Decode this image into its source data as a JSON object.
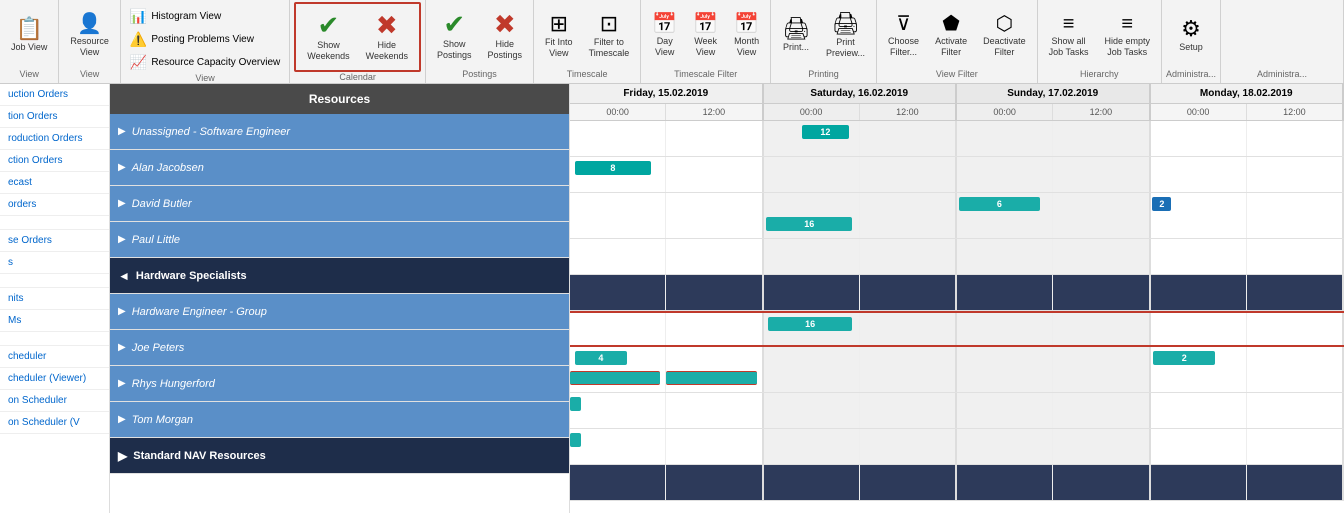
{
  "toolbar": {
    "groups": [
      {
        "id": "job-view",
        "label": "View",
        "buttons": [
          {
            "id": "job-view-btn",
            "icon": "📋",
            "label": "Job\nView",
            "type": "large"
          }
        ]
      },
      {
        "id": "resource-view",
        "label": "View",
        "buttons": [
          {
            "id": "resource-view-btn",
            "icon": "👤",
            "label": "Resource\nView",
            "type": "large"
          }
        ]
      },
      {
        "id": "view-group",
        "label": "View",
        "sub_buttons": [
          {
            "id": "histogram-view",
            "icon": "📊",
            "label": "Histogram View"
          },
          {
            "id": "posting-problems",
            "icon": "⚠️",
            "label": "Posting Problems View"
          },
          {
            "id": "resource-capacity",
            "icon": "📈",
            "label": "Resource Capacity Overview"
          }
        ]
      },
      {
        "id": "calendar-group",
        "label": "Calendar",
        "buttons": [
          {
            "id": "show-weekends",
            "icon": "✔",
            "label": "Show\nWeekends",
            "color": "green"
          },
          {
            "id": "hide-weekends",
            "icon": "✖",
            "label": "Hide\nWeekends",
            "color": "red"
          }
        ]
      },
      {
        "id": "postings-group",
        "label": "Postings",
        "buttons": [
          {
            "id": "show-postings",
            "icon": "✔",
            "label": "Show\nPostings",
            "color": "green"
          },
          {
            "id": "hide-postings",
            "icon": "✖",
            "label": "Hide\nPostings",
            "color": "red"
          }
        ]
      },
      {
        "id": "timescale-group",
        "label": "Timescale",
        "buttons": [
          {
            "id": "fit-into-view",
            "icon": "⊞",
            "label": "Fit Into\nView"
          },
          {
            "id": "filter-timescale",
            "icon": "⊡",
            "label": "Filter to\nTimescale"
          }
        ]
      },
      {
        "id": "day-week-month-group",
        "label": "Timescale Filter",
        "buttons": [
          {
            "id": "day-view",
            "icon": "📅",
            "label": "Day\nView"
          },
          {
            "id": "week-view",
            "icon": "📅",
            "label": "Week\nView"
          },
          {
            "id": "month-view",
            "icon": "📅",
            "label": "Month\nView"
          }
        ]
      },
      {
        "id": "printing-group",
        "label": "Printing",
        "buttons": [
          {
            "id": "print-btn",
            "icon": "🖨",
            "label": "Print..."
          },
          {
            "id": "print-preview",
            "icon": "🖨",
            "label": "Print\nPreview..."
          }
        ]
      },
      {
        "id": "view-filter-group",
        "label": "View Filter",
        "buttons": [
          {
            "id": "choose-filter",
            "icon": "▼",
            "label": "Choose\nFilter..."
          },
          {
            "id": "activate-filter",
            "icon": "⬟",
            "label": "Activate\nFilter"
          },
          {
            "id": "deactivate-filter",
            "icon": "⬟",
            "label": "Deactivate\nFilter"
          }
        ]
      },
      {
        "id": "hierarchy-group",
        "label": "Hierarchy",
        "buttons": [
          {
            "id": "show-all-job-tasks",
            "icon": "≡",
            "label": "Show all\nJob Tasks"
          },
          {
            "id": "hide-empty-job-tasks",
            "icon": "≡",
            "label": "Hide empty\nJob Tasks"
          }
        ]
      },
      {
        "id": "setup-group",
        "label": "Administra...",
        "buttons": [
          {
            "id": "setup-btn",
            "icon": "⚙",
            "label": "Setup"
          }
        ]
      }
    ]
  },
  "sidebar_nav": {
    "items": [
      {
        "id": "production-orders-1",
        "label": "uction Orders"
      },
      {
        "id": "tion-orders",
        "label": "tion Orders"
      },
      {
        "id": "production-orders-3",
        "label": "roduction Orders"
      },
      {
        "id": "ction-orders",
        "label": "ction Orders"
      },
      {
        "id": "ecast",
        "label": "ecast"
      },
      {
        "id": "orders",
        "label": "orders"
      },
      {
        "id": "empty1",
        "label": ""
      },
      {
        "id": "se-orders",
        "label": "se Orders"
      },
      {
        "id": "s",
        "label": "s"
      },
      {
        "id": "empty2",
        "label": ""
      },
      {
        "id": "nits",
        "label": "nits"
      },
      {
        "id": "ms",
        "label": "Ms"
      },
      {
        "id": "empty3",
        "label": ""
      },
      {
        "id": "scheduler",
        "label": "cheduler"
      },
      {
        "id": "scheduler-viewer",
        "label": "cheduler (Viewer)"
      },
      {
        "id": "on-scheduler",
        "label": "on Scheduler"
      },
      {
        "id": "on-scheduler-v",
        "label": "on Scheduler (V"
      }
    ]
  },
  "resources_header": "Resources",
  "resources": [
    {
      "id": "unassigned-sw",
      "name": "Unassigned - Software Engineer",
      "level": 1,
      "type": "resource",
      "expanded": false
    },
    {
      "id": "alan-jacobsen",
      "name": "Alan Jacobsen",
      "level": 1,
      "type": "resource",
      "expanded": false
    },
    {
      "id": "david-butler",
      "name": "David Butler",
      "level": 1,
      "type": "resource",
      "expanded": false
    },
    {
      "id": "paul-little",
      "name": "Paul Little",
      "level": 1,
      "type": "resource",
      "expanded": false
    },
    {
      "id": "hardware-specialists",
      "name": "Hardware Specialists",
      "level": 0,
      "type": "group",
      "expanded": true
    },
    {
      "id": "hardware-engineer-group",
      "name": "Hardware Engineer - Group",
      "level": 1,
      "type": "resource",
      "expanded": false
    },
    {
      "id": "joe-peters",
      "name": "Joe Peters",
      "level": 1,
      "type": "resource",
      "expanded": false
    },
    {
      "id": "rhys-hungerford",
      "name": "Rhys Hungerford",
      "level": 1,
      "type": "resource",
      "expanded": false
    },
    {
      "id": "tom-morgan",
      "name": "Tom Morgan",
      "level": 1,
      "type": "resource",
      "expanded": false
    },
    {
      "id": "standard-nav-resources",
      "name": "Standard NAV Resources",
      "level": 0,
      "type": "group",
      "expanded": false
    }
  ],
  "gantt": {
    "dates": [
      {
        "label": "Friday, 15.02.2019",
        "times": [
          "00:00",
          "12:00"
        ]
      },
      {
        "label": "Saturday, 16.02.2019",
        "times": [
          "00:00",
          "12:00"
        ]
      },
      {
        "label": "Sunday, 17.02.2019",
        "times": [
          "00:00",
          "12:00"
        ]
      },
      {
        "label": "Monday, 18.02.2019",
        "times": [
          "00:00",
          "12:00"
        ]
      }
    ],
    "rows": [
      {
        "id": "row-unassigned-sw",
        "bars": [
          {
            "type": "teal",
            "day": 1,
            "start": 0.5,
            "width": 0.45,
            "label": "12",
            "row": "top"
          }
        ],
        "weekend": true
      },
      {
        "id": "row-alan-jacobsen",
        "bars": [
          {
            "type": "teal",
            "day": 0,
            "start": 0.1,
            "width": 0.7,
            "label": "8",
            "row": "top"
          }
        ]
      },
      {
        "id": "row-david-butler",
        "bars": [
          {
            "type": "teal",
            "day": 2,
            "start": 0.0,
            "width": 0.9,
            "label": "6",
            "row": "top"
          },
          {
            "type": "blue",
            "day": 3,
            "start": 0.0,
            "width": 0.15,
            "label": "2",
            "row": "top"
          },
          {
            "type": "teal",
            "day": 1,
            "start": 0.05,
            "width": 0.9,
            "label": "16",
            "row": "bottom"
          }
        ]
      },
      {
        "id": "row-paul-little",
        "bars": []
      },
      {
        "id": "row-hardware-specialists",
        "bars": [],
        "is_group": true
      },
      {
        "id": "row-hardware-engineer-group",
        "bars": [
          {
            "type": "teal",
            "day": 1,
            "start": 0.1,
            "width": 0.8,
            "label": "16",
            "row": "top"
          }
        ],
        "red_border": true,
        "weekend": true
      },
      {
        "id": "row-joe-peters",
        "bars": [
          {
            "type": "teal",
            "day": 0,
            "start": 0.1,
            "width": 0.5,
            "label": "4",
            "row": "top"
          },
          {
            "type": "teal",
            "day": 3,
            "start": 0.05,
            "width": 0.6,
            "label": "2",
            "row": "top"
          }
        ]
      },
      {
        "id": "row-rhys-hungerford",
        "bars": [
          {
            "type": "teal",
            "day": 0,
            "start": 0.0,
            "width": 0.1,
            "label": "",
            "row": "top"
          }
        ]
      },
      {
        "id": "row-tom-morgan",
        "bars": [
          {
            "type": "teal",
            "day": 0,
            "start": 0.0,
            "width": 0.1,
            "label": "",
            "row": "top"
          }
        ]
      },
      {
        "id": "row-standard-nav",
        "bars": [],
        "is_group": true
      }
    ]
  },
  "colors": {
    "teal_bar": "#1aada8",
    "blue_bar": "#1a6eb5",
    "gold_bar": "#d4a017",
    "header_dark": "#3d3d3d",
    "resource_blue": "#4a7fc1",
    "group_dark": "#1e3a5f",
    "weekend_bg": "#e8e8e8",
    "red_border": "#c0392b",
    "calendar_highlight": "#c0392b"
  }
}
